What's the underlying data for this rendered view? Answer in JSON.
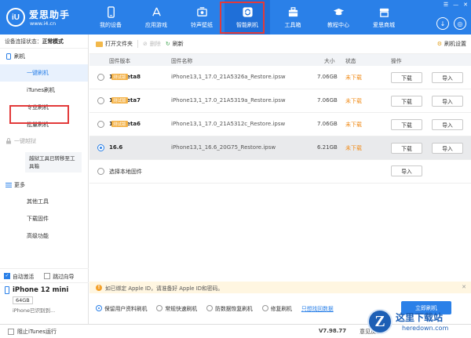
{
  "logo": {
    "mark": "iU",
    "name": "爱思助手",
    "url": "www.i4.cn"
  },
  "nav": [
    {
      "label": "我的设备",
      "icon": "device-icon"
    },
    {
      "label": "应用游戏",
      "icon": "app-store-icon"
    },
    {
      "label": "铃声壁纸",
      "icon": "ringtone-icon"
    },
    {
      "label": "智能刷机",
      "icon": "flash-icon"
    },
    {
      "label": "工具箱",
      "icon": "toolbox-icon"
    },
    {
      "label": "教程中心",
      "icon": "tutorial-icon"
    },
    {
      "label": "爱思商城",
      "icon": "store-icon"
    }
  ],
  "sidebar": {
    "status_label": "设备连接状态：",
    "status_value": "正常模式",
    "flash_head": "刷机",
    "flash_items": [
      "一键刷机",
      "iTunes刷机",
      "专业刷机",
      "批量刷机"
    ],
    "jailbreak_head": "一键越狱",
    "jailbreak_note": "越狱工具已转移至工具箱",
    "more_head": "更多",
    "more_items": [
      "其他工具",
      "下载固件",
      "高级功能"
    ],
    "auto_activate": "自动激活",
    "skip_guide": "跳过向导",
    "device_name": "iPhone 12 mini",
    "device_capacity": "64GB",
    "device_desc": "iPhone已识别到..."
  },
  "toolbar": {
    "open_folder": "打开文件夹",
    "delete": "删除",
    "refresh": "刷新",
    "settings": "刷机设置"
  },
  "table": {
    "headers": {
      "version": "固件版本",
      "name": "固件名称",
      "size": "大小",
      "status": "状态",
      "action": "操作"
    },
    "rows": [
      {
        "version": "17.0beta8",
        "tag": "测试版",
        "name": "iPhone13,1_17.0_21A5326a_Restore.ipsw",
        "size": "7.06GB",
        "status": "未下载",
        "selected": false
      },
      {
        "version": "17.0beta7",
        "tag": "测试版",
        "name": "iPhone13,1_17.0_21A5319a_Restore.ipsw",
        "size": "7.06GB",
        "status": "未下载",
        "selected": false
      },
      {
        "version": "17.0beta6",
        "tag": "测试版",
        "name": "iPhone13,1_17.0_21A5312c_Restore.ipsw",
        "size": "7.06GB",
        "status": "未下载",
        "selected": false
      },
      {
        "version": "16.6",
        "tag": "",
        "name": "iPhone13,1_16.6_20G75_Restore.ipsw",
        "size": "6.21GB",
        "status": "未下载",
        "selected": true
      }
    ],
    "download_label": "下载",
    "import_label": "导入",
    "local_firmware": "选择本地固件"
  },
  "notice": "如已绑定 Apple ID，请准备好 Apple ID和密码。",
  "options": [
    {
      "label": "保留用户资料刷机",
      "selected": true
    },
    {
      "label": "常规快速刷机",
      "selected": false
    },
    {
      "label": "防数据恢复刷机",
      "selected": false
    },
    {
      "label": "修复刷机",
      "selected": false
    }
  ],
  "options_link": "只想找回数据",
  "flash_button": "立即刷机",
  "statusbar": {
    "block_itunes": "阻止iTunes运行",
    "version": "V7.98.77",
    "feedback": "意见反馈"
  },
  "watermark": {
    "mark": "Z",
    "name": "这里下载站",
    "url": "heredown.com"
  },
  "colors": {
    "brand": "#2a80e8",
    "warning": "#f08c1a",
    "highlight": "#e23a3a",
    "tag": "#f4b247"
  }
}
